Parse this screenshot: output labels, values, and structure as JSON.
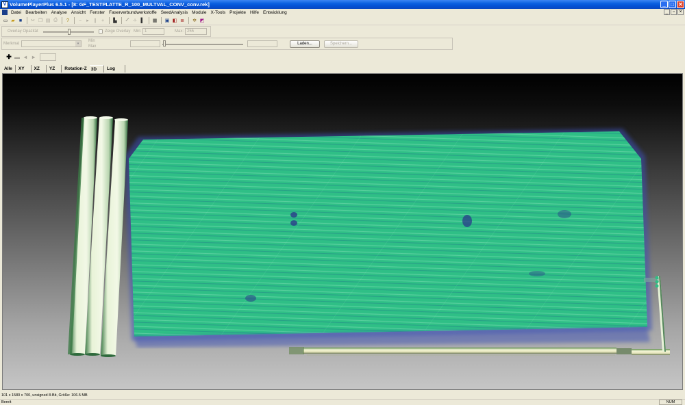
{
  "window": {
    "title": "VolumePlayerPlus 6.5.1 - [8: GF_TESTPLATTE_R_100_MULTVAL_CONV_conv.rek]",
    "minimize": "_",
    "maximize": "□",
    "close": "✕"
  },
  "menu": [
    "Datei",
    "Bearbeiten",
    "Analyse",
    "Ansicht",
    "Fenster",
    "Faserverbundwerkstoffe",
    "SeedAnalysis",
    "Module",
    "X-Tools",
    "Projekte",
    "Hilfe",
    "Entwicklung"
  ],
  "overlay": {
    "opacity_label": "Overlay Opazität",
    "show_overlay_label": "Zeige Overlay",
    "min_label": "Min:",
    "min_value": "1",
    "max_label": "Max:",
    "max_value": "255"
  },
  "merkmal": {
    "label": "Merkmal",
    "min_label": "Min",
    "max_label": "Max",
    "load_button": "Laden...",
    "save_button": "Speichern..."
  },
  "tabs": [
    "Alle",
    "XY",
    "XZ",
    "YZ",
    "Rotation-Z",
    "3D",
    "Log"
  ],
  "status": {
    "info": "101 x 1580 x 700,   unsigned 8-Bit,  Größe: 106.5 MB",
    "ready": "Bereit",
    "num": "NUM"
  },
  "colors": {
    "volume": "#2fbf86",
    "volume_dark": "#3b4fb5",
    "rods": "#e6f2d6"
  }
}
